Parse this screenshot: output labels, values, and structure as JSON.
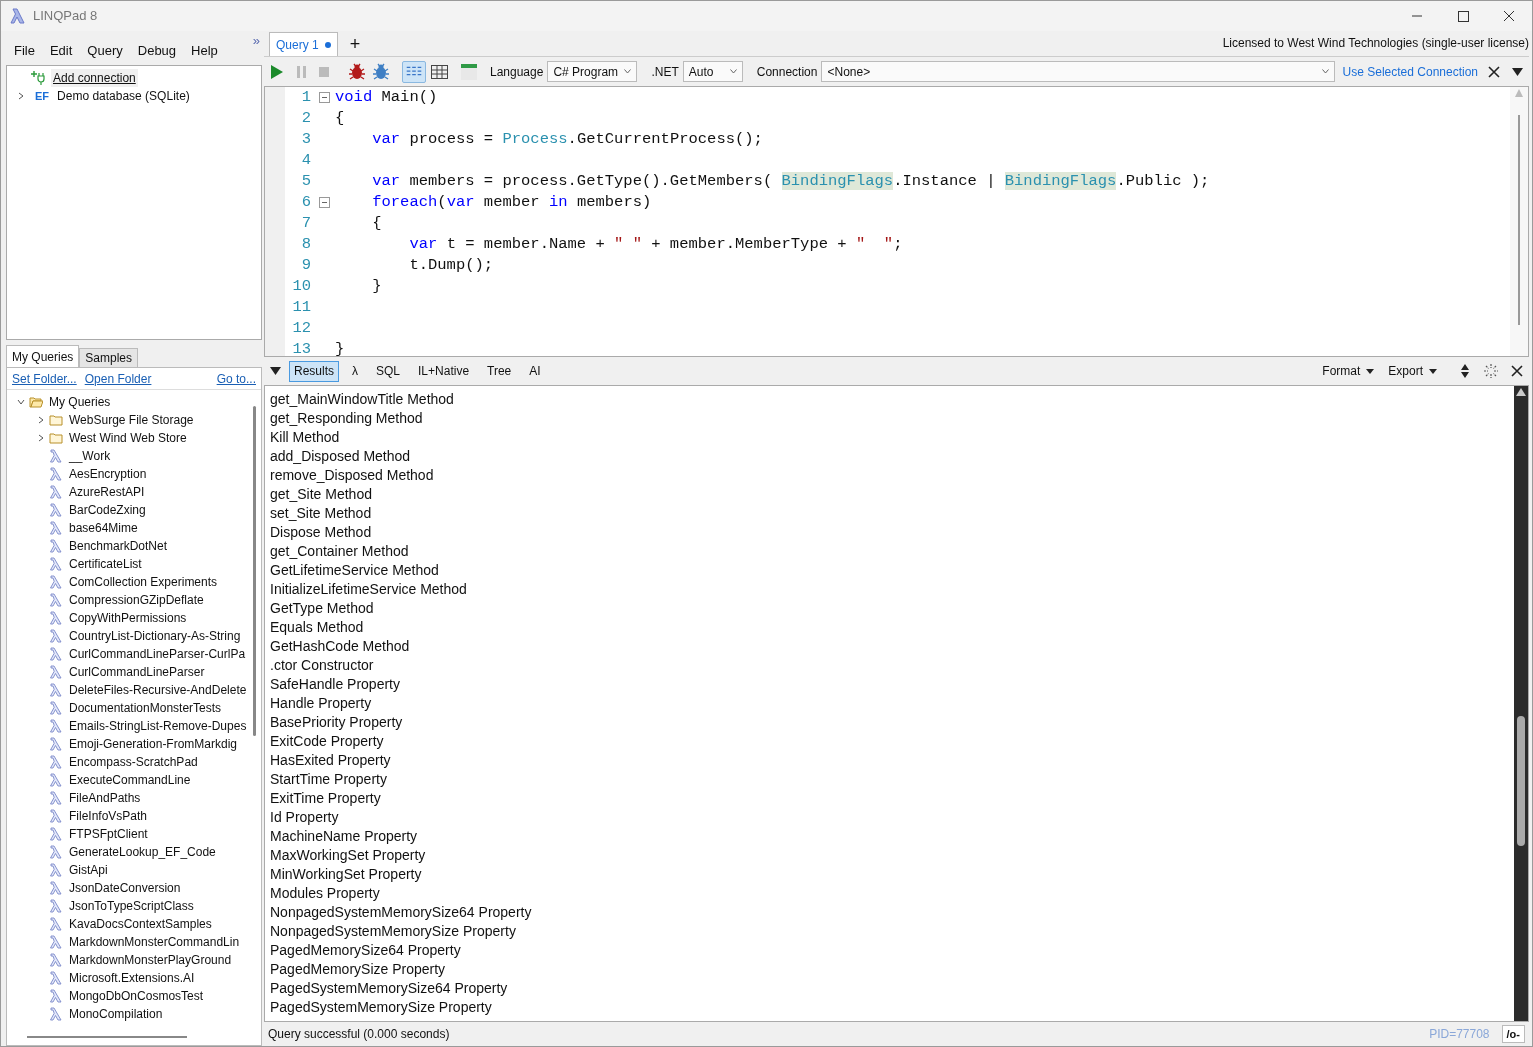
{
  "window": {
    "title": "LINQPad 8"
  },
  "menu": [
    "File",
    "Edit",
    "Query",
    "Debug",
    "Help"
  ],
  "collapse_button": "»",
  "connections": [
    {
      "kind": "add",
      "label": "Add connection"
    },
    {
      "kind": "ef",
      "badge": "EF",
      "label": "Demo database (SQLite)",
      "expanded": false
    }
  ],
  "sidebar_tabs": [
    {
      "label": "My Queries",
      "selected": true
    },
    {
      "label": "Samples",
      "selected": false
    }
  ],
  "folder_links": {
    "left": [
      "Set Folder...",
      "Open Folder"
    ],
    "right": "Go to..."
  },
  "query_tree": [
    {
      "kind": "folder",
      "label": "My Queries",
      "expanded": true,
      "children": [
        {
          "kind": "folder",
          "label": "WebSurge File Storage",
          "expanded": false
        },
        {
          "kind": "folder",
          "label": "West Wind Web Store",
          "expanded": false
        },
        {
          "kind": "query",
          "label": "__Work"
        },
        {
          "kind": "query",
          "label": "AesEncryption"
        },
        {
          "kind": "query",
          "label": "AzureRestAPI"
        },
        {
          "kind": "query",
          "label": "BarCodeZxing"
        },
        {
          "kind": "query",
          "label": "base64Mime"
        },
        {
          "kind": "query",
          "label": "BenchmarkDotNet"
        },
        {
          "kind": "query",
          "label": "CertificateList"
        },
        {
          "kind": "query",
          "label": "ComCollection Experiments"
        },
        {
          "kind": "query",
          "label": "CompressionGZipDeflate"
        },
        {
          "kind": "query",
          "label": "CopyWithPermissions"
        },
        {
          "kind": "query",
          "label": "CountryList-Dictionary-As-String"
        },
        {
          "kind": "query",
          "label": "CurlCommandLineParser-CurlPa"
        },
        {
          "kind": "query",
          "label": "CurlCommandLineParser"
        },
        {
          "kind": "query",
          "label": "DeleteFiles-Recursive-AndDelete"
        },
        {
          "kind": "query",
          "label": "DocumentationMonsterTests"
        },
        {
          "kind": "query",
          "label": "Emails-StringList-Remove-Dupes"
        },
        {
          "kind": "query",
          "label": "Emoji-Generation-FromMarkdig"
        },
        {
          "kind": "query",
          "label": "Encompass-ScratchPad"
        },
        {
          "kind": "query",
          "label": "ExecuteCommandLine"
        },
        {
          "kind": "query",
          "label": "FileAndPaths"
        },
        {
          "kind": "query",
          "label": "FileInfoVsPath"
        },
        {
          "kind": "query",
          "label": "FTPSFptClient"
        },
        {
          "kind": "query",
          "label": "GenerateLookup_EF_Code"
        },
        {
          "kind": "query",
          "label": "GistApi"
        },
        {
          "kind": "query",
          "label": "JsonDateConversion"
        },
        {
          "kind": "query",
          "label": "JsonToTypeScriptClass"
        },
        {
          "kind": "query",
          "label": "KavaDocsContextSamples"
        },
        {
          "kind": "query",
          "label": "MarkdownMonsterCommandLin"
        },
        {
          "kind": "query",
          "label": "MarkdownMonsterPlayGround"
        },
        {
          "kind": "query",
          "label": "Microsoft.Extensions.AI"
        },
        {
          "kind": "query",
          "label": "MongoDbOnCosmosTest"
        },
        {
          "kind": "query",
          "label": "MonoCompilation"
        }
      ]
    }
  ],
  "query_tabs": [
    {
      "label": "Query 1",
      "selected": true,
      "modified": true
    }
  ],
  "new_tab": "+",
  "license": "Licensed to West Wind Technologies (single-user license)",
  "toolbar": {
    "language_label": "Language",
    "language": "C# Program",
    "dotnet_label": ".NET",
    "dotnet": "Auto",
    "connection_label": "Connection",
    "connection": "<None>",
    "use_connection": "Use Selected Connection",
    "view_buttons": [
      {
        "kind": "rich",
        "selected": true
      },
      {
        "kind": "grid",
        "selected": false
      }
    ]
  },
  "editor": {
    "lines": [
      {
        "n": "1",
        "fold": true,
        "segs": [
          {
            "kind": "keyword",
            "text": "void"
          },
          {
            "kind": "plain",
            "text": " Main()"
          }
        ]
      },
      {
        "n": "2",
        "fold": false,
        "segs": [
          {
            "kind": "plain",
            "text": "{"
          }
        ]
      },
      {
        "n": "3",
        "fold": false,
        "segs": [
          {
            "kind": "keyword",
            "text": "    var"
          },
          {
            "kind": "plain",
            "text": " process = "
          },
          {
            "kind": "type",
            "text": "Process"
          },
          {
            "kind": "plain",
            "text": ".GetCurrentProcess();"
          }
        ]
      },
      {
        "n": "4",
        "fold": false
      },
      {
        "n": "5",
        "fold": false,
        "segs": [
          {
            "kind": "keyword",
            "text": "    var"
          },
          {
            "kind": "plain",
            "text": " members = process.GetType().GetMembers( "
          },
          {
            "kind": "highlight",
            "text": "BindingFlags"
          },
          {
            "kind": "plain",
            "text": ".Instance | "
          },
          {
            "kind": "highlight",
            "text": "BindingFlags"
          },
          {
            "kind": "plain",
            "text": ".Public );"
          }
        ]
      },
      {
        "n": "6",
        "fold": true,
        "segs": [
          {
            "kind": "keyword",
            "text": "    foreach"
          },
          {
            "kind": "plain",
            "text": "("
          },
          {
            "kind": "keyword",
            "text": "var"
          },
          {
            "kind": "plain",
            "text": " member "
          },
          {
            "kind": "keyword",
            "text": "in"
          },
          {
            "kind": "plain",
            "text": " members)"
          }
        ]
      },
      {
        "n": "7",
        "fold": false,
        "segs": [
          {
            "kind": "plain",
            "text": "    {"
          }
        ]
      },
      {
        "n": "8",
        "fold": false,
        "segs": [
          {
            "kind": "keyword",
            "text": "        var"
          },
          {
            "kind": "plain",
            "text": " t = member.Name + "
          },
          {
            "kind": "string",
            "text": "\" \""
          },
          {
            "kind": "plain",
            "text": " + member.MemberType + "
          },
          {
            "kind": "string",
            "text": "\"  \""
          },
          {
            "kind": "plain",
            "text": ";"
          }
        ]
      },
      {
        "n": "9",
        "fold": false,
        "segs": [
          {
            "kind": "plain",
            "text": "        t.Dump();"
          }
        ]
      },
      {
        "n": "10",
        "fold": false,
        "segs": [
          {
            "kind": "plain",
            "text": "    }"
          }
        ]
      },
      {
        "n": "11",
        "fold": false
      },
      {
        "n": "12",
        "fold": false
      },
      {
        "n": "13",
        "fold": false,
        "segs": [
          {
            "kind": "plain",
            "text": "}"
          }
        ]
      }
    ]
  },
  "result_tabs": [
    {
      "label": "Results",
      "selected": true
    },
    {
      "label": "λ",
      "selected": false
    },
    {
      "label": "SQL",
      "selected": false
    },
    {
      "label": "IL+Native",
      "selected": false
    },
    {
      "label": "Tree",
      "selected": false
    },
    {
      "label": "AI",
      "selected": false
    }
  ],
  "result_menus": [
    "Format",
    "Export"
  ],
  "results": [
    "get_MainWindowTitle Method",
    "get_Responding Method",
    "Kill Method",
    "add_Disposed Method",
    "remove_Disposed Method",
    "get_Site Method",
    "set_Site Method",
    "Dispose Method",
    "get_Container Method",
    "GetLifetimeService Method",
    "InitializeLifetimeService Method",
    "GetType Method",
    "Equals Method",
    "GetHashCode Method",
    ".ctor Constructor",
    "SafeHandle Property",
    "Handle Property",
    "BasePriority Property",
    "ExitCode Property",
    "HasExited Property",
    "StartTime Property",
    "ExitTime Property",
    "Id Property",
    "MachineName Property",
    "MaxWorkingSet Property",
    "MinWorkingSet Property",
    "Modules Property",
    "NonpagedSystemMemorySize64 Property",
    "NonpagedSystemMemorySize Property",
    "PagedMemorySize64 Property",
    "PagedMemorySize Property",
    "PagedSystemMemorySize64 Property",
    "PagedSystemMemorySize Property"
  ],
  "status_bar": {
    "message": "Query successful  (0.000 seconds)",
    "pid": "PID=77708",
    "button": "/o-"
  }
}
